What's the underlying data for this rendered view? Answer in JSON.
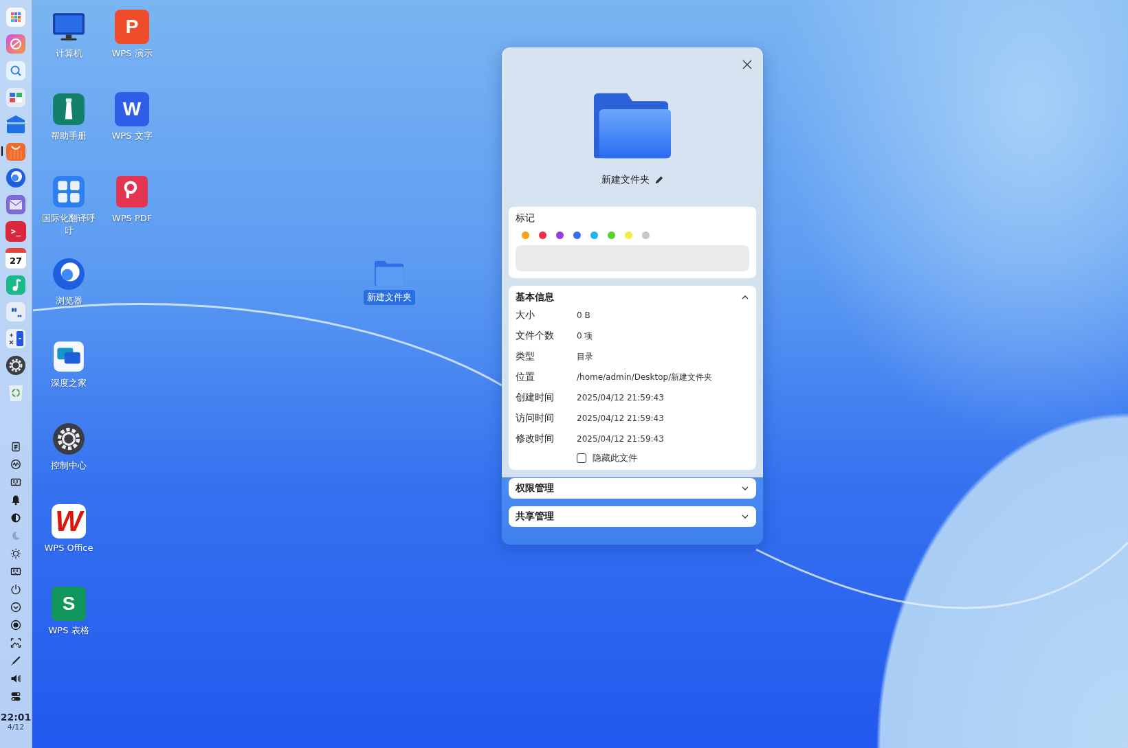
{
  "dock": {
    "apps": [
      {
        "kind": "grid",
        "active": false
      },
      {
        "kind": "swirl",
        "active": false
      },
      {
        "kind": "search",
        "active": false
      },
      {
        "kind": "window",
        "active": false
      },
      {
        "kind": "files",
        "active": false
      },
      {
        "kind": "bag",
        "active": true
      },
      {
        "kind": "browser",
        "active": false
      },
      {
        "kind": "mail",
        "active": false
      },
      {
        "kind": "terminal",
        "active": false,
        "glyph": ">_"
      },
      {
        "kind": "calendar",
        "active": false,
        "glyph": "27"
      },
      {
        "kind": "music",
        "active": false
      },
      {
        "kind": "quote",
        "active": false
      },
      {
        "kind": "calculator",
        "active": false
      },
      {
        "kind": "gear",
        "active": false
      },
      {
        "kind": "trash",
        "active": false
      }
    ],
    "tray": [
      {
        "kind": "clipboard",
        "dimmed": false
      },
      {
        "kind": "gauge",
        "dimmed": false
      },
      {
        "kind": "keyboard",
        "dimmed": false
      },
      {
        "kind": "bell",
        "dimmed": false
      },
      {
        "kind": "contrast",
        "dimmed": false
      },
      {
        "kind": "moon",
        "dimmed": true
      },
      {
        "kind": "sun",
        "dimmed": false
      },
      {
        "kind": "keyboard",
        "dimmed": false
      },
      {
        "kind": "power",
        "dimmed": false
      },
      {
        "kind": "chevron",
        "dimmed": false
      },
      {
        "kind": "record",
        "dimmed": false
      },
      {
        "kind": "screenshot",
        "dimmed": false
      },
      {
        "kind": "pen",
        "dimmed": false
      },
      {
        "kind": "speaker",
        "dimmed": false
      },
      {
        "kind": "toggle",
        "dimmed": false
      }
    ],
    "clock": {
      "time": "22:01",
      "date": "4/12"
    }
  },
  "desktop_icons": [
    {
      "label": "计算机",
      "kind": "monitor"
    },
    {
      "label": "帮助手册",
      "kind": "lighthouse"
    },
    {
      "label": "国际化翻译呼吁",
      "kind": "translate"
    },
    {
      "label": "浏览器",
      "kind": "browser"
    },
    {
      "label": "深度之家",
      "kind": "chat"
    },
    {
      "label": "控制中心",
      "kind": "gear"
    },
    {
      "label": "WPS Office",
      "kind": "office",
      "glyph": "W"
    },
    {
      "label": "WPS 表格",
      "kind": "sheet",
      "glyph": "S"
    },
    {
      "label": "WPS 演示",
      "kind": "presentation",
      "glyph": "P"
    },
    {
      "label": "WPS 文字",
      "kind": "doc",
      "glyph": "W"
    },
    {
      "label": "WPS PDF",
      "kind": "pdf"
    }
  ],
  "desktop_folder": {
    "label": "新建文件夹",
    "selected": true
  },
  "properties_dialog": {
    "name": "新建文件夹",
    "tags": {
      "title": "标记",
      "colors": [
        {
          "color": "#f8a21c"
        },
        {
          "color": "#f02e48"
        },
        {
          "color": "#9a3ce8"
        },
        {
          "color": "#3e6ef0"
        },
        {
          "color": "#1eb4f0"
        },
        {
          "color": "#5cd32a"
        },
        {
          "color": "#f0ef47"
        },
        {
          "color": "#c8c8c8"
        }
      ]
    },
    "basic_info": {
      "title": "基本信息",
      "expanded": true,
      "rows": [
        {
          "label": "大小",
          "value": "0 B"
        },
        {
          "label": "文件个数",
          "value": "0 项"
        },
        {
          "label": "类型",
          "value": "目录"
        },
        {
          "label": "位置",
          "value": "/home/admin/Desktop/新建文件夹"
        },
        {
          "label": "创建时间",
          "value": "2025/04/12 21:59:43"
        },
        {
          "label": "访问时间",
          "value": "2025/04/12 21:59:43"
        },
        {
          "label": "修改时间",
          "value": "2025/04/12 21:59:43"
        }
      ],
      "hide_file": {
        "label": "隐藏此文件",
        "checked": false
      }
    },
    "sections": [
      {
        "title": "权限管理",
        "expanded": false
      },
      {
        "title": "共享管理",
        "expanded": false
      }
    ]
  }
}
